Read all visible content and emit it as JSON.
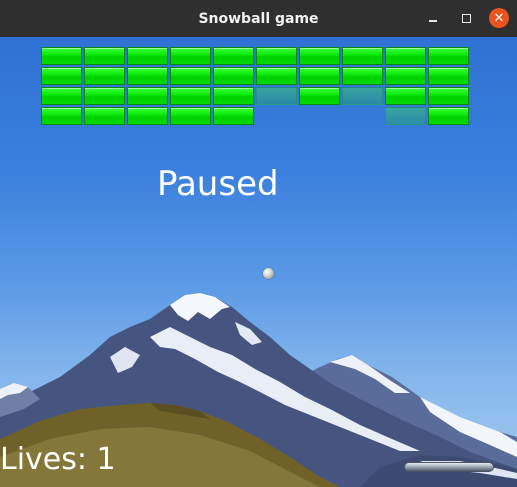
{
  "window": {
    "title": "Snowball game",
    "controls": {
      "minimize_icon": "minimize-icon",
      "maximize_icon": "maximize-icon",
      "close_icon": "close-icon",
      "close_glyph": "✕"
    }
  },
  "game": {
    "status_text": "Paused",
    "lives_text": "Lives: 1",
    "colors": {
      "brick": "#00e600",
      "close_button": "#e95420",
      "sky_top": "#2f71d3"
    },
    "brick_grid": {
      "columns": 10,
      "rows": [
        [
          1,
          1,
          1,
          1,
          1,
          1,
          1,
          1,
          1,
          1
        ],
        [
          1,
          1,
          1,
          1,
          1,
          1,
          1,
          1,
          1,
          1
        ],
        [
          1,
          1,
          1,
          1,
          1,
          0.5,
          1,
          0.5,
          1,
          1
        ],
        [
          1,
          1,
          1,
          1,
          1,
          0,
          0,
          0,
          0.5,
          1
        ]
      ]
    }
  }
}
